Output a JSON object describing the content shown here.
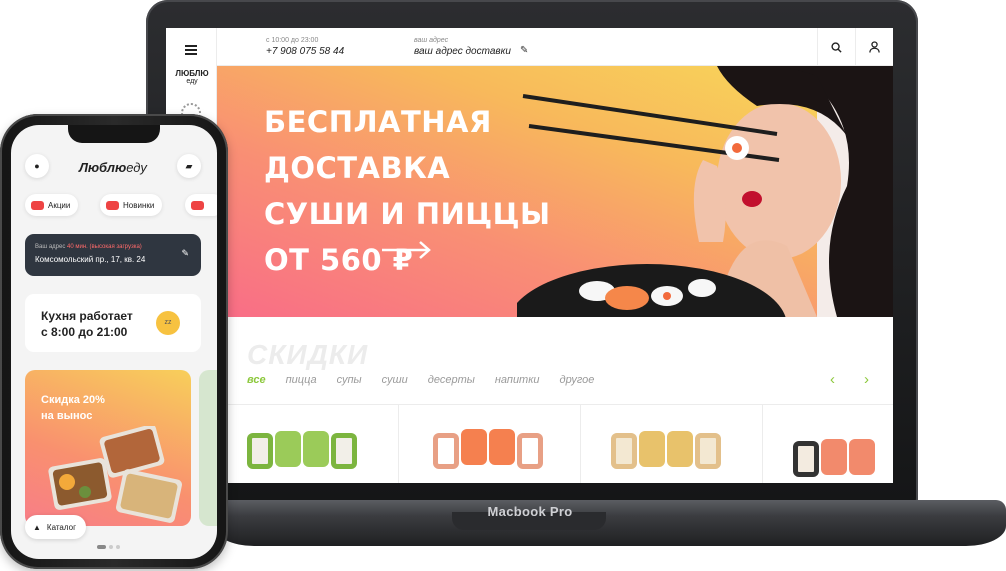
{
  "laptop": {
    "brand": "Macbook Pro",
    "site": {
      "logo_top": "ЛЮБЛЮ",
      "logo_bottom": "еду",
      "hours_label": "с 10:00 до 23:00",
      "phone": "+7 908 075 58 44",
      "address_label": "ваш адрес",
      "address_value": "ваш адрес доставки",
      "hero": {
        "lines": [
          "БЕСПЛАТНАЯ",
          "ДОСТАВКА",
          "СУШИ И ПИЦЦЫ",
          "ОТ 560 ₽"
        ]
      },
      "discounts_title": "СКИДКИ",
      "tabs": [
        "все",
        "пицца",
        "супы",
        "суши",
        "десерты",
        "напитки",
        "другое"
      ],
      "active_tab": "все",
      "icons": [
        "menu-icon",
        "search-icon",
        "user-icon",
        "edit-icon",
        "chevron-left-icon",
        "chevron-right-icon"
      ]
    }
  },
  "phone": {
    "logo_bold": "Люблю",
    "logo_light": "еду",
    "chips": [
      "Акции",
      "Новинки"
    ],
    "address_label": "Ваш адрес",
    "address_note": "40 мин. (высокая загрузка)",
    "address_value": "Комсомольский пр., 17, кв. 24",
    "work_text_1": "Кухня работает",
    "work_text_2": "с 8:00 до 21:00",
    "promo_1": "Скидка 20%",
    "promo_2": "на вынос",
    "catalog": "Каталог"
  },
  "colors": {
    "accent_green": "#8cc83c",
    "hero_gradient_start": "#f96d87",
    "hero_gradient_end": "#f8dc5a",
    "dark_card": "#2f3640"
  }
}
